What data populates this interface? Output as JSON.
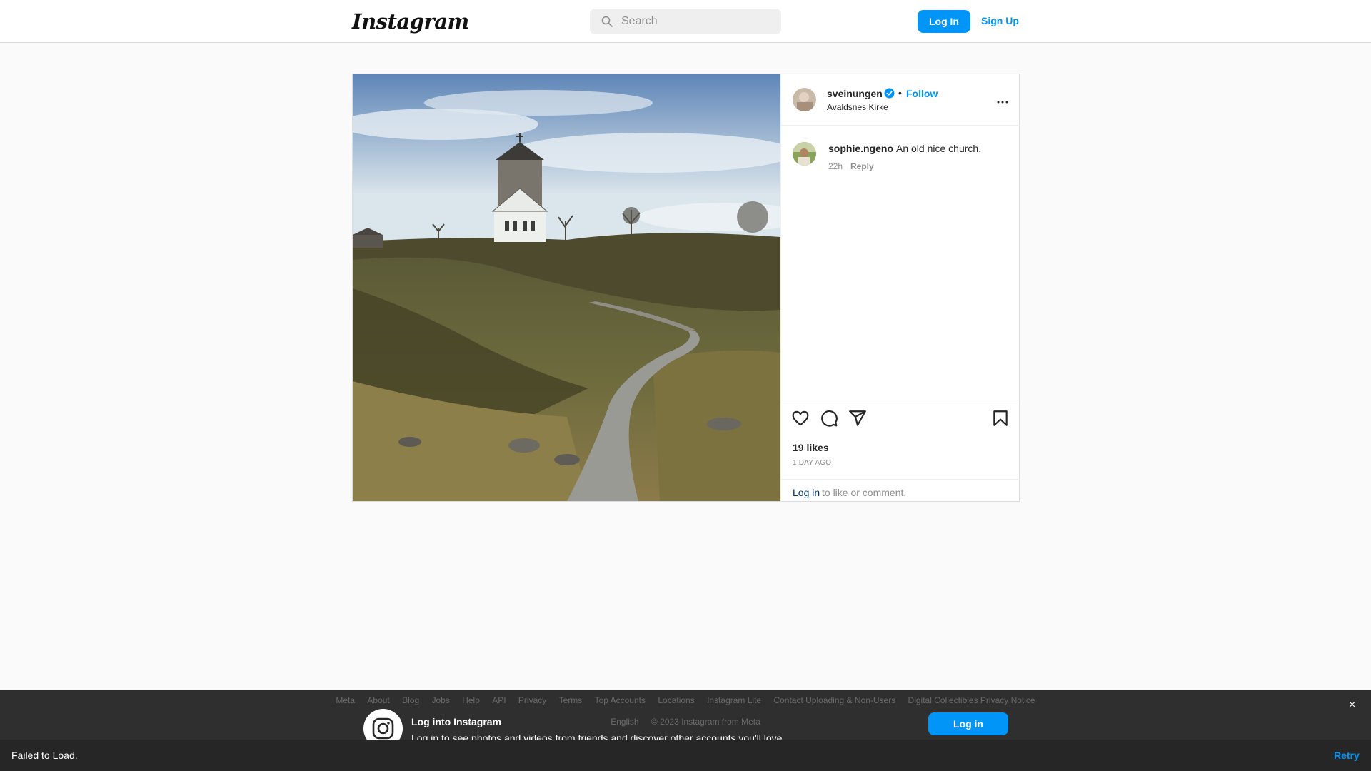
{
  "nav": {
    "logo": "Instagram",
    "search_placeholder": "Search",
    "login_label": "Log In",
    "signup_label": "Sign Up"
  },
  "post": {
    "author": "sveinungen",
    "follow_label": "Follow",
    "separator": "•",
    "location": "Avaldsnes Kirke",
    "comments": [
      {
        "user": "sophie.ngeno",
        "text": "An old nice church.",
        "time": "22h",
        "reply_label": "Reply"
      }
    ],
    "likes": "19 likes",
    "time_ago": "1 DAY AGO",
    "login_link": "Log in",
    "login_prompt_rest": "to like or comment."
  },
  "footer": {
    "links": [
      "Meta",
      "About",
      "Blog",
      "Jobs",
      "Help",
      "API",
      "Privacy",
      "Terms",
      "Top Accounts",
      "Locations",
      "Instagram Lite",
      "Contact Uploading & Non-Users",
      "Digital Collectibles Privacy Notice"
    ],
    "language": "English",
    "copyright": "© 2023 Instagram from Meta"
  },
  "banner": {
    "title": "Log into Instagram",
    "subtitle": "Log in to see photos and videos from friends and discover other accounts you'll love.",
    "login_label": "Log in",
    "close_label": "×"
  },
  "error": {
    "text": "Failed to Load.",
    "retry_label": "Retry"
  },
  "colors": {
    "accent": "#0095f6",
    "verified": "#0095f6",
    "banner_bg": "#2f2f2f"
  }
}
